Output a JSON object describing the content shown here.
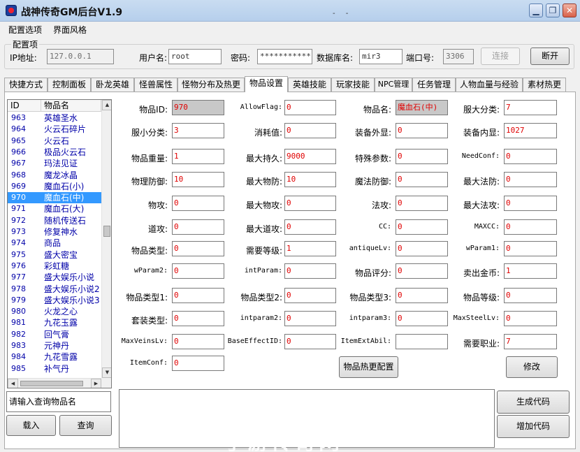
{
  "window": {
    "title": "战神传奇GM后台V1.9",
    "dots": "- -"
  },
  "menu": [
    "配置选项",
    "界面风格"
  ],
  "config": {
    "group_title": "配置项",
    "ip_label": "IP地址:",
    "ip_value": "127.0.0.1",
    "user_label": "用户名:",
    "user_value": "root",
    "pass_label": "密码:",
    "pass_value": "***********",
    "db_label": "数据库名:",
    "db_value": "mir3",
    "port_label": "端口号:",
    "port_value": "3306",
    "connect_label": "连接",
    "disconnect_label": "断开"
  },
  "tabs": [
    "快捷方式",
    "控制面板",
    "卧龙英雄",
    "怪兽属性",
    "怪物分布及热更",
    "物品设置",
    "英雄技能",
    "玩家技能",
    "NPC管理",
    "任务管理",
    "人物血量与经验",
    "素材热更"
  ],
  "list": {
    "headers": [
      "ID",
      "物品名"
    ],
    "rows": [
      {
        "id": "963",
        "name": "英雄圣水"
      },
      {
        "id": "964",
        "name": "火云石碎片"
      },
      {
        "id": "965",
        "name": "火云石"
      },
      {
        "id": "966",
        "name": "极品火云石"
      },
      {
        "id": "967",
        "name": "玛法见证"
      },
      {
        "id": "968",
        "name": "魔龙冰晶"
      },
      {
        "id": "969",
        "name": "魔血石(小)"
      },
      {
        "id": "970",
        "name": "魔血石(中)"
      },
      {
        "id": "971",
        "name": "魔血石(大)"
      },
      {
        "id": "972",
        "name": "随机传送石"
      },
      {
        "id": "973",
        "name": "修复神水"
      },
      {
        "id": "974",
        "name": "商品"
      },
      {
        "id": "975",
        "name": "盛大密宝"
      },
      {
        "id": "976",
        "name": "彩虹糖"
      },
      {
        "id": "977",
        "name": "盛大娱乐小说"
      },
      {
        "id": "978",
        "name": "盛大娱乐小说2"
      },
      {
        "id": "979",
        "name": "盛大娱乐小说3"
      },
      {
        "id": "980",
        "name": "火龙之心"
      },
      {
        "id": "981",
        "name": "九花玉露"
      },
      {
        "id": "982",
        "name": "回气膏"
      },
      {
        "id": "983",
        "name": "元神丹"
      },
      {
        "id": "984",
        "name": "九花雪露"
      },
      {
        "id": "985",
        "name": "补气丹"
      }
    ]
  },
  "fields": [
    [
      {
        "label": "物品ID:",
        "value": "970"
      },
      {
        "label": "AllowFlag:",
        "value": "0"
      },
      {
        "label": "物品名:",
        "value": "魔血石(中)"
      },
      {
        "label": "服大分类:",
        "value": "7"
      }
    ],
    [
      {
        "label": "服小分类:",
        "value": "3"
      },
      {
        "label": "消耗值:",
        "value": "0"
      },
      {
        "label": "装备外显:",
        "value": "0"
      },
      {
        "label": "装备内显:",
        "value": "1027"
      }
    ],
    [
      {
        "label": "物品重量:",
        "value": "1"
      },
      {
        "label": "最大持久:",
        "value": "9000"
      },
      {
        "label": "特殊参数:",
        "value": "0"
      },
      {
        "label": "NeedConf:",
        "value": "0"
      }
    ],
    [
      {
        "label": "物理防御:",
        "value": "10"
      },
      {
        "label": "最大物防:",
        "value": "10"
      },
      {
        "label": "魔法防御:",
        "value": "0"
      },
      {
        "label": "最大法防:",
        "value": "0"
      }
    ],
    [
      {
        "label": "物攻:",
        "value": "0"
      },
      {
        "label": "最大物攻:",
        "value": "0"
      },
      {
        "label": "法攻:",
        "value": "0"
      },
      {
        "label": "最大法攻:",
        "value": "0"
      }
    ],
    [
      {
        "label": "道攻:",
        "value": "0"
      },
      {
        "label": "最大道攻:",
        "value": "0"
      },
      {
        "label": "CC:",
        "value": "0"
      },
      {
        "label": "MAXCC:",
        "value": "0"
      }
    ],
    [
      {
        "label": "物品类型:",
        "value": "0"
      },
      {
        "label": "需要等级:",
        "value": "1"
      },
      {
        "label": "antiqueLv:",
        "value": "0"
      },
      {
        "label": "wParam1:",
        "value": "0"
      }
    ],
    [
      {
        "label": "wParam2:",
        "value": "0"
      },
      {
        "label": "intParam:",
        "value": "0"
      },
      {
        "label": "物品评分:",
        "value": "0"
      },
      {
        "label": "卖出金币:",
        "value": "1"
      }
    ],
    [
      {
        "label": "物品类型1:",
        "value": "0"
      },
      {
        "label": "物品类型2:",
        "value": "0"
      },
      {
        "label": "物品类型3:",
        "value": "0"
      },
      {
        "label": "物品等级:",
        "value": "0"
      }
    ],
    [
      {
        "label": "套装类型:",
        "value": "0"
      },
      {
        "label": "intparam2:",
        "value": "0"
      },
      {
        "label": "intparam3:",
        "value": "0"
      },
      {
        "label": "MaxSteelLv:",
        "value": "0"
      }
    ],
    [
      {
        "label": "MaxVeinsLv:",
        "value": "0"
      },
      {
        "label": "BaseEffectID:",
        "value": "0"
      },
      {
        "label": "ItemExtAbil:",
        "value": ""
      },
      {
        "label": "需要职业:",
        "value": "7"
      }
    ],
    [
      {
        "label": "ItemConf:",
        "value": "0"
      }
    ]
  ],
  "actions": {
    "hot_update_label": "物品热更配置",
    "modify_label": "修改",
    "search_placeholder": "请输入查询物品名",
    "load_label": "载入",
    "query_label": "查询",
    "gen_label": "生成代码",
    "add_label": "增加代码"
  },
  "watermark": "手游传奇网",
  "colors": {
    "value_text": "#e00000",
    "list_text": "#0000a8",
    "selected_row": "#3399ff"
  }
}
